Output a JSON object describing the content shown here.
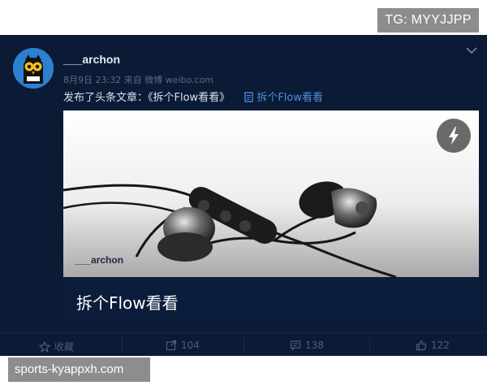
{
  "watermarks": {
    "top": "TG: MYYJJPP",
    "bottom": "sports-kyappxh.com"
  },
  "post": {
    "username": "___archon",
    "meta": "8月9日 23:32 来自 微博 weibo.com",
    "text": "发布了头条文章：《拆个Flow看看》",
    "article_link": "拆个Flow看看"
  },
  "media": {
    "photo_author": "___archon",
    "title": "拆个Flow看看",
    "icon": "flash-icon"
  },
  "actions": {
    "favorite": "收藏",
    "repost": "104",
    "comment": "138",
    "like": "122"
  },
  "colors": {
    "background": "#0b1a35",
    "accent": "#4f8fe0"
  }
}
